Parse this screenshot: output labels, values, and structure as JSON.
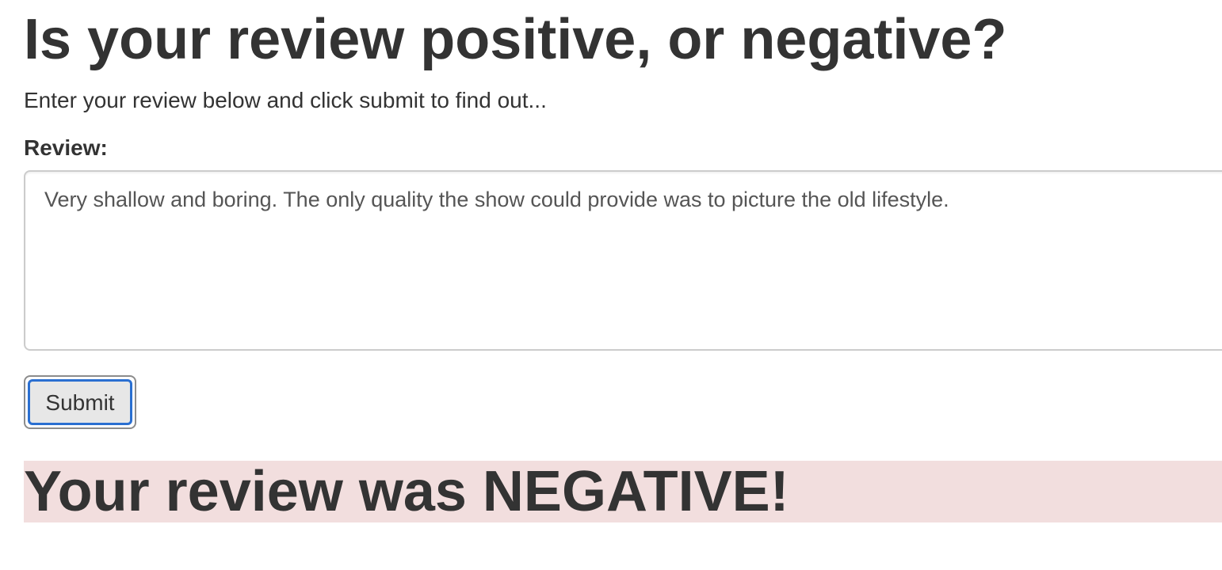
{
  "header": {
    "title": "Is your review positive, or negative?",
    "subtitle": "Enter your review below and click submit to find out..."
  },
  "form": {
    "review_label": "Review:",
    "review_value": "Very shallow and boring. The only quality the show could provide was to picture the old lifestyle.",
    "submit_label": "Submit"
  },
  "result": {
    "text": "Your review was NEGATIVE!",
    "background_color": "#f2dede"
  },
  "colors": {
    "text": "#333333",
    "focus_ring": "#2a6fd1"
  }
}
